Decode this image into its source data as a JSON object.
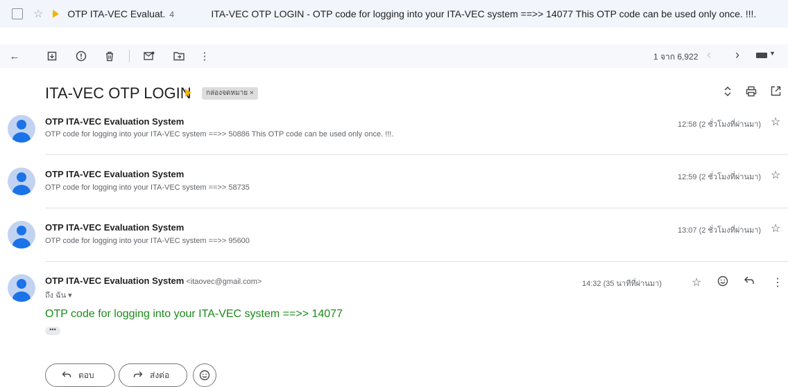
{
  "inbox_row": {
    "sender": "OTP ITA-VEC Evaluat.",
    "count": "4",
    "subject": "ITA-VEC OTP LOGIN",
    "snippet": " - OTP code for logging into your ITA-VEC system ==>> 14077 This OTP code can be used only once. !!!."
  },
  "toolbar": {
    "pager": "1 จาก 6,922"
  },
  "thread": {
    "subject": "ITA-VEC OTP LOGIN",
    "label": "กล่องจดหมาย ×"
  },
  "messages": [
    {
      "sender": "OTP ITA-VEC Evaluation System",
      "snippet": "OTP code for logging into your ITA-VEC system ==>> 50886 This OTP code can be used only once. !!!.",
      "time": "12:58 (2 ชั่วโมงที่ผ่านมา)"
    },
    {
      "sender": "OTP ITA-VEC Evaluation System",
      "snippet": "OTP code for logging into your ITA-VEC system ==>> 58735",
      "time": "12:59 (2 ชั่วโมงที่ผ่านมา)"
    },
    {
      "sender": "OTP ITA-VEC Evaluation System",
      "snippet": "OTP code for logging into your ITA-VEC system ==>> 95600",
      "time": "13:07 (2 ชั่วโมงที่ผ่านมา)"
    }
  ],
  "open_message": {
    "sender": "OTP ITA-VEC Evaluation System",
    "email": "<itaovec@gmail.com>",
    "to": "ถึง ฉัน ▾",
    "time": "14:32 (35 นาทีที่ผ่านมา)",
    "body": "OTP code for logging into your ITA-VEC system ==>> 14077",
    "dots": "•••"
  },
  "actions": {
    "reply": "ตอบ",
    "forward": "ส่งต่อ"
  },
  "colors": {
    "body_green": "#1b8a1b",
    "important": "#f4b400",
    "avatar_blue": "#1a73e8"
  }
}
